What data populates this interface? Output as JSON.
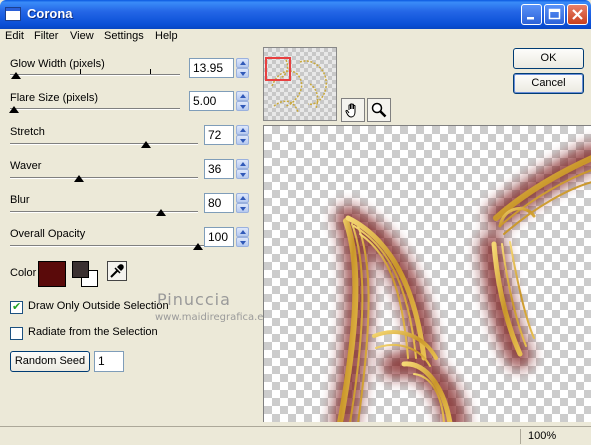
{
  "window": {
    "title": "Corona",
    "controls": [
      "minimize",
      "maximize",
      "close"
    ]
  },
  "menu": [
    "Edit",
    "Filter",
    "View",
    "Settings",
    "Help"
  ],
  "settings": {
    "glow_width": {
      "label": "Glow Width (pixels)",
      "value": "13.95"
    },
    "flare_size": {
      "label": "Flare Size (pixels)",
      "value": "5.00"
    },
    "stretch": {
      "label": "Stretch",
      "value": "72"
    },
    "waver": {
      "label": "Waver",
      "value": "36"
    },
    "blur": {
      "label": "Blur",
      "value": "80"
    },
    "overall_opacity": {
      "label": "Overall Opacity",
      "value": "100"
    }
  },
  "color": {
    "label": "Color",
    "swatch_hex": "#5a0a0a",
    "fg_hex": "#3a3030",
    "bg_hex": "#ffffff"
  },
  "options": {
    "draw_only_outside": {
      "label": "Draw Only Outside Selection",
      "checked": true
    },
    "radiate_from_selection": {
      "label": "Radiate from the Selection",
      "checked": false
    }
  },
  "random_seed": {
    "button_label": "Random Seed",
    "value": "1"
  },
  "buttons": {
    "ok": "OK",
    "cancel": "Cancel"
  },
  "watermark": {
    "line1": "Pinuccia",
    "line2": "www.maidiregrafica.eu"
  },
  "tools": [
    "hand-tool",
    "zoom-tool"
  ],
  "status": {
    "zoom": "100%"
  }
}
